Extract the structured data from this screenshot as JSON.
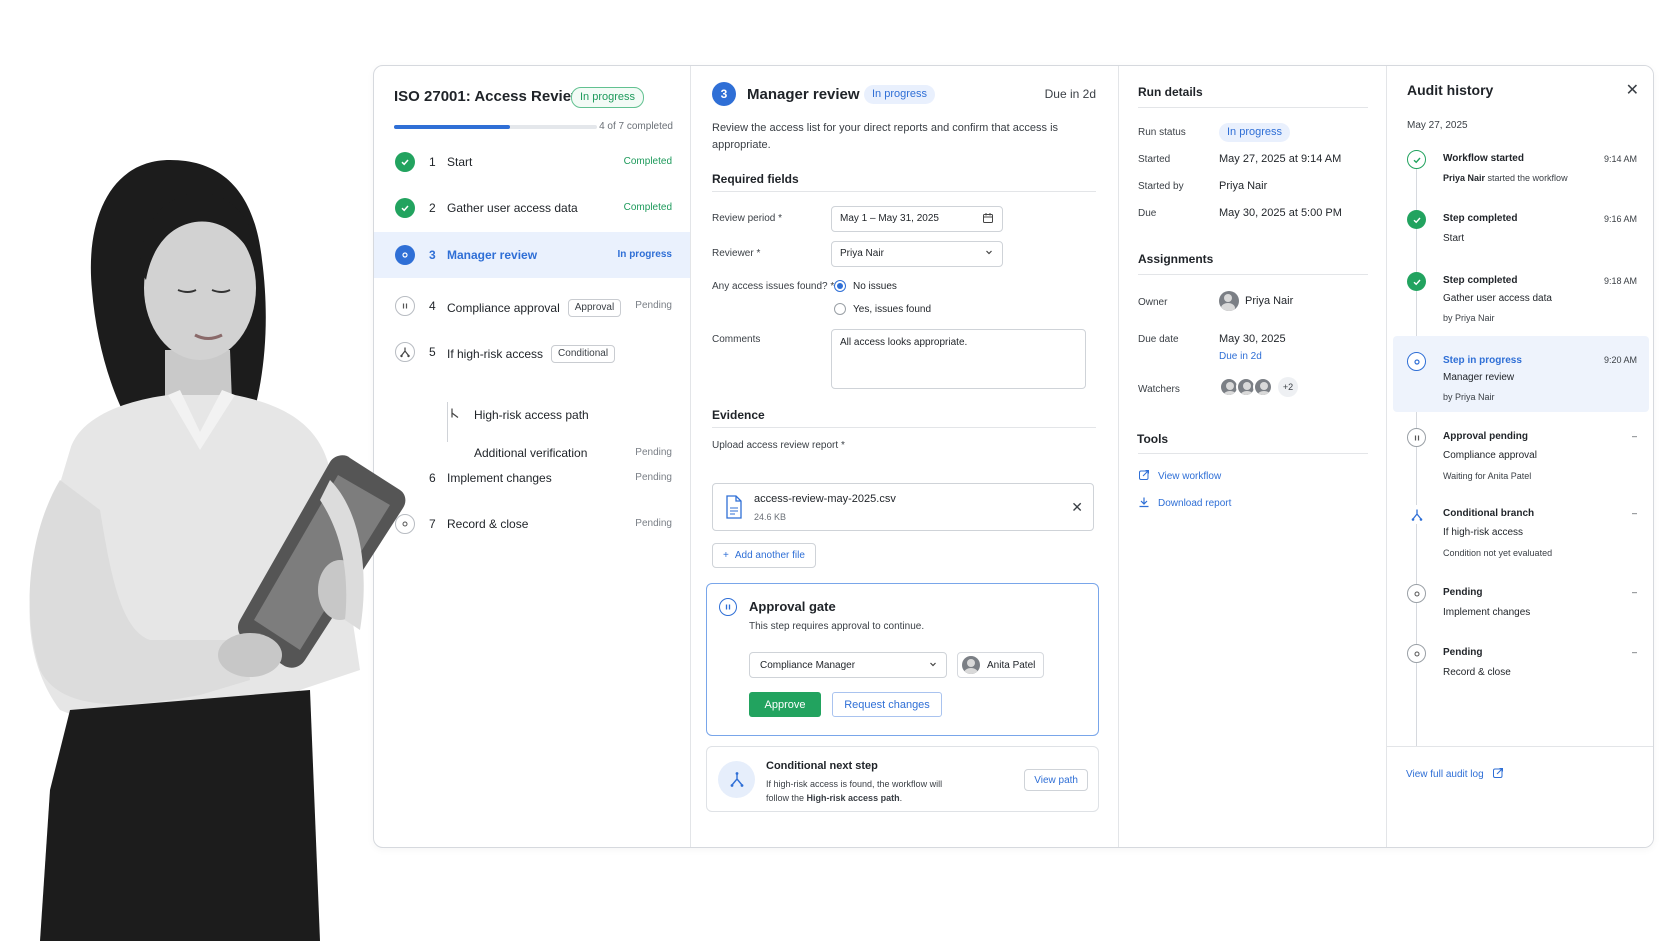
{
  "steps": {
    "title": "ISO 27001: Access Review",
    "badge": "In progress",
    "progress_label": "4 of 7 completed",
    "progress_fraction": 0.57,
    "items": [
      {
        "num": "1",
        "name": "Start",
        "status": "Completed"
      },
      {
        "num": "2",
        "name": "Gather user access data",
        "status": "Completed"
      },
      {
        "num": "3",
        "name": "Manager review",
        "status": "In progress"
      },
      {
        "num": "4",
        "name": "Compliance approval",
        "tag": "Approval",
        "status": "Pending"
      },
      {
        "num": "5",
        "name": "If high-risk access",
        "tag": "Conditional",
        "status": ""
      },
      {
        "num": "6",
        "name": "Implement changes",
        "status": "Pending"
      },
      {
        "num": "7",
        "name": "Record & close",
        "status": "Pending"
      }
    ],
    "subitems": [
      {
        "name": "High-risk access path",
        "status": ""
      },
      {
        "name": "Additional verification",
        "status": "Pending"
      }
    ]
  },
  "main": {
    "step_num": "3",
    "title": "Manager review",
    "badge": "In progress",
    "due": "Due in 2d",
    "description": "Review the access list for your direct reports and confirm that access is appropriate.",
    "required_fields": "Required fields",
    "review_period_label": "Review period *",
    "review_period_value": "May 1 – May 31, 2025",
    "reviewer_label": "Reviewer *",
    "reviewer_value": "Priya Nair",
    "issues_label": "Any access issues found? *",
    "radio_no": "No issues",
    "radio_yes": "Yes, issues found",
    "comments_label": "Comments",
    "comments_value": "All access looks appropriate.",
    "evidence": "Evidence",
    "upload_label": "Upload access review report *",
    "file_name": "access-review-may-2025.csv",
    "file_size": "24.6 KB",
    "add_file": "Add another file",
    "gate": {
      "title": "Approval gate",
      "description": "This step requires approval to continue.",
      "role": "Compliance Manager",
      "approver": "Anita Patel",
      "approve": "Approve",
      "request_changes": "Request changes"
    },
    "conditional": {
      "title": "Conditional next step",
      "desc_1": "If high-risk access is found, the workflow will",
      "desc_2": "follow the ",
      "desc_bold": "High-risk access path",
      "desc_end": ".",
      "button": "View path"
    }
  },
  "run": {
    "title": "Run details",
    "status_label": "Run status",
    "status_value": "In progress",
    "started_label": "Started",
    "started_value": "May 27, 2025 at 9:14 AM",
    "started_by_label": "Started by",
    "started_by_value": "Priya Nair",
    "due_label": "Due",
    "due_value": "May 30, 2025 at 5:00 PM",
    "assignments": "Assignments",
    "owner_label": "Owner",
    "owner_value": "Priya Nair",
    "due_date_label": "Due date",
    "due_date_value": "May 30, 2025",
    "due_in": "Due in 2d",
    "watchers_label": "Watchers",
    "watchers_more": "+2",
    "tools": "Tools",
    "view_workflow": "View workflow",
    "download_report": "Download report"
  },
  "audit": {
    "title": "Audit history",
    "date": "May 27, 2025",
    "events": [
      {
        "head": "Workflow started",
        "time": "9:14 AM",
        "line1": "Priya Nair",
        "line1_rest": " started the workflow",
        "line2": ""
      },
      {
        "head": "Step completed",
        "time": "9:16 AM",
        "line1": "Start",
        "line2": ""
      },
      {
        "head": "Step completed",
        "time": "9:18 AM",
        "line1": "Gather user access data",
        "line2": "by Priya Nair"
      },
      {
        "head": "Step in progress",
        "time": "9:20 AM",
        "line1": "Manager review",
        "line2": "by Priya Nair"
      },
      {
        "head": "Approval pending",
        "time": "–",
        "line1": "Compliance approval",
        "line2": "Waiting for Anita Patel"
      },
      {
        "head": "Conditional branch",
        "time": "–",
        "line1": "If high-risk access",
        "line2": "Condition not yet evaluated"
      },
      {
        "head": "Pending",
        "time": "–",
        "line1": "Implement changes",
        "line2": ""
      },
      {
        "head": "Pending",
        "time": "–",
        "line1": "Record & close",
        "line2": ""
      }
    ],
    "footer_link": "View full audit log"
  },
  "colors": {
    "accent": "#2f6fd6",
    "success": "#22a35f"
  }
}
